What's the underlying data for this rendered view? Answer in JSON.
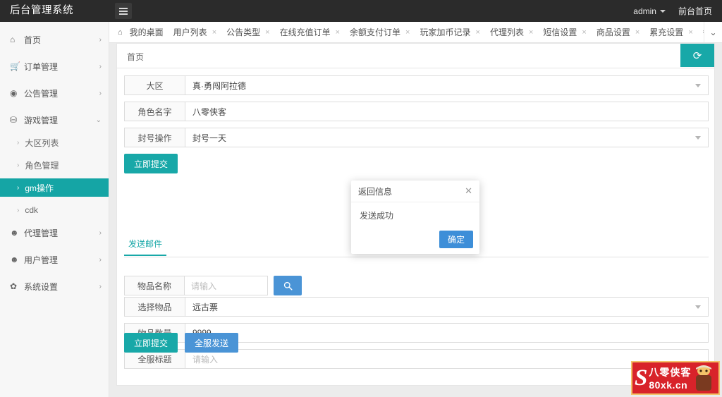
{
  "topbar": {
    "brand": "后台管理系统",
    "admin_label": "admin",
    "front_link": "前台首页",
    "menu_icon": "hamburger-icon"
  },
  "sidebar": {
    "items": [
      {
        "label": "首页",
        "icon": "home-icon",
        "arrow": "›",
        "active": false
      },
      {
        "label": "订单管理",
        "icon": "cart-icon",
        "arrow": "›",
        "active": false
      },
      {
        "label": "公告管理",
        "icon": "megaphone-icon",
        "arrow": "›",
        "active": false
      },
      {
        "label": "游戏管理",
        "icon": "gamepad-icon",
        "arrow": "⌄",
        "active": false
      }
    ],
    "sub_items": [
      {
        "label": "大区列表",
        "active": false
      },
      {
        "label": "角色管理",
        "active": false
      },
      {
        "label": "gm操作",
        "active": true
      },
      {
        "label": "cdk",
        "active": false
      }
    ],
    "items_after": [
      {
        "label": "代理管理",
        "icon": "user-icon",
        "arrow": "›",
        "active": false
      },
      {
        "label": "用户管理",
        "icon": "user-icon",
        "arrow": "›",
        "active": false
      },
      {
        "label": "系统设置",
        "icon": "gear-icon",
        "arrow": "›",
        "active": false
      }
    ]
  },
  "tabs": [
    {
      "label": "我的桌面",
      "closable": false,
      "home": true
    },
    {
      "label": "用户列表",
      "closable": true
    },
    {
      "label": "公告类型",
      "closable": true
    },
    {
      "label": "在线充值订单",
      "closable": true
    },
    {
      "label": "余额支付订单",
      "closable": true
    },
    {
      "label": "玩家加币记录",
      "closable": true
    },
    {
      "label": "代理列表",
      "closable": true
    },
    {
      "label": "短信设置",
      "closable": true
    },
    {
      "label": "商品设置",
      "closable": true
    },
    {
      "label": "累充设置",
      "closable": true
    },
    {
      "label": "每日累充",
      "closable": true
    }
  ],
  "breadcrumb": "首页",
  "refresh_icon": "refresh-icon",
  "form": {
    "region_label": "大区",
    "region_value": "真·勇闯阿拉德",
    "role_label": "角色名字",
    "role_value": "八零侠客",
    "ban_label": "封号操作",
    "ban_value": "封号一天",
    "submit_label": "立即提交"
  },
  "inner_tab": "发送邮件",
  "mail": {
    "item_name_label": "物品名称",
    "item_name_placeholder": "请输入",
    "search_icon": "search-icon",
    "select_item_label": "选择物品",
    "select_item_value": "远古票",
    "item_count_label": "物品数量",
    "item_count_value": "9999",
    "server_title_label": "全服标题",
    "server_title_placeholder": "请输入",
    "submit_label": "立即提交",
    "send_all_label": "全服发送"
  },
  "modal": {
    "title": "返回信息",
    "close_icon": "close-icon",
    "body": "发送成功",
    "ok_label": "确定"
  },
  "watermark": {
    "mark": "S",
    "line1": "八零侠客",
    "line2": "80xk.cn"
  },
  "colors": {
    "accent": "#18a8a8",
    "blue": "#4a94d6",
    "topbar": "#2b2b2b"
  }
}
